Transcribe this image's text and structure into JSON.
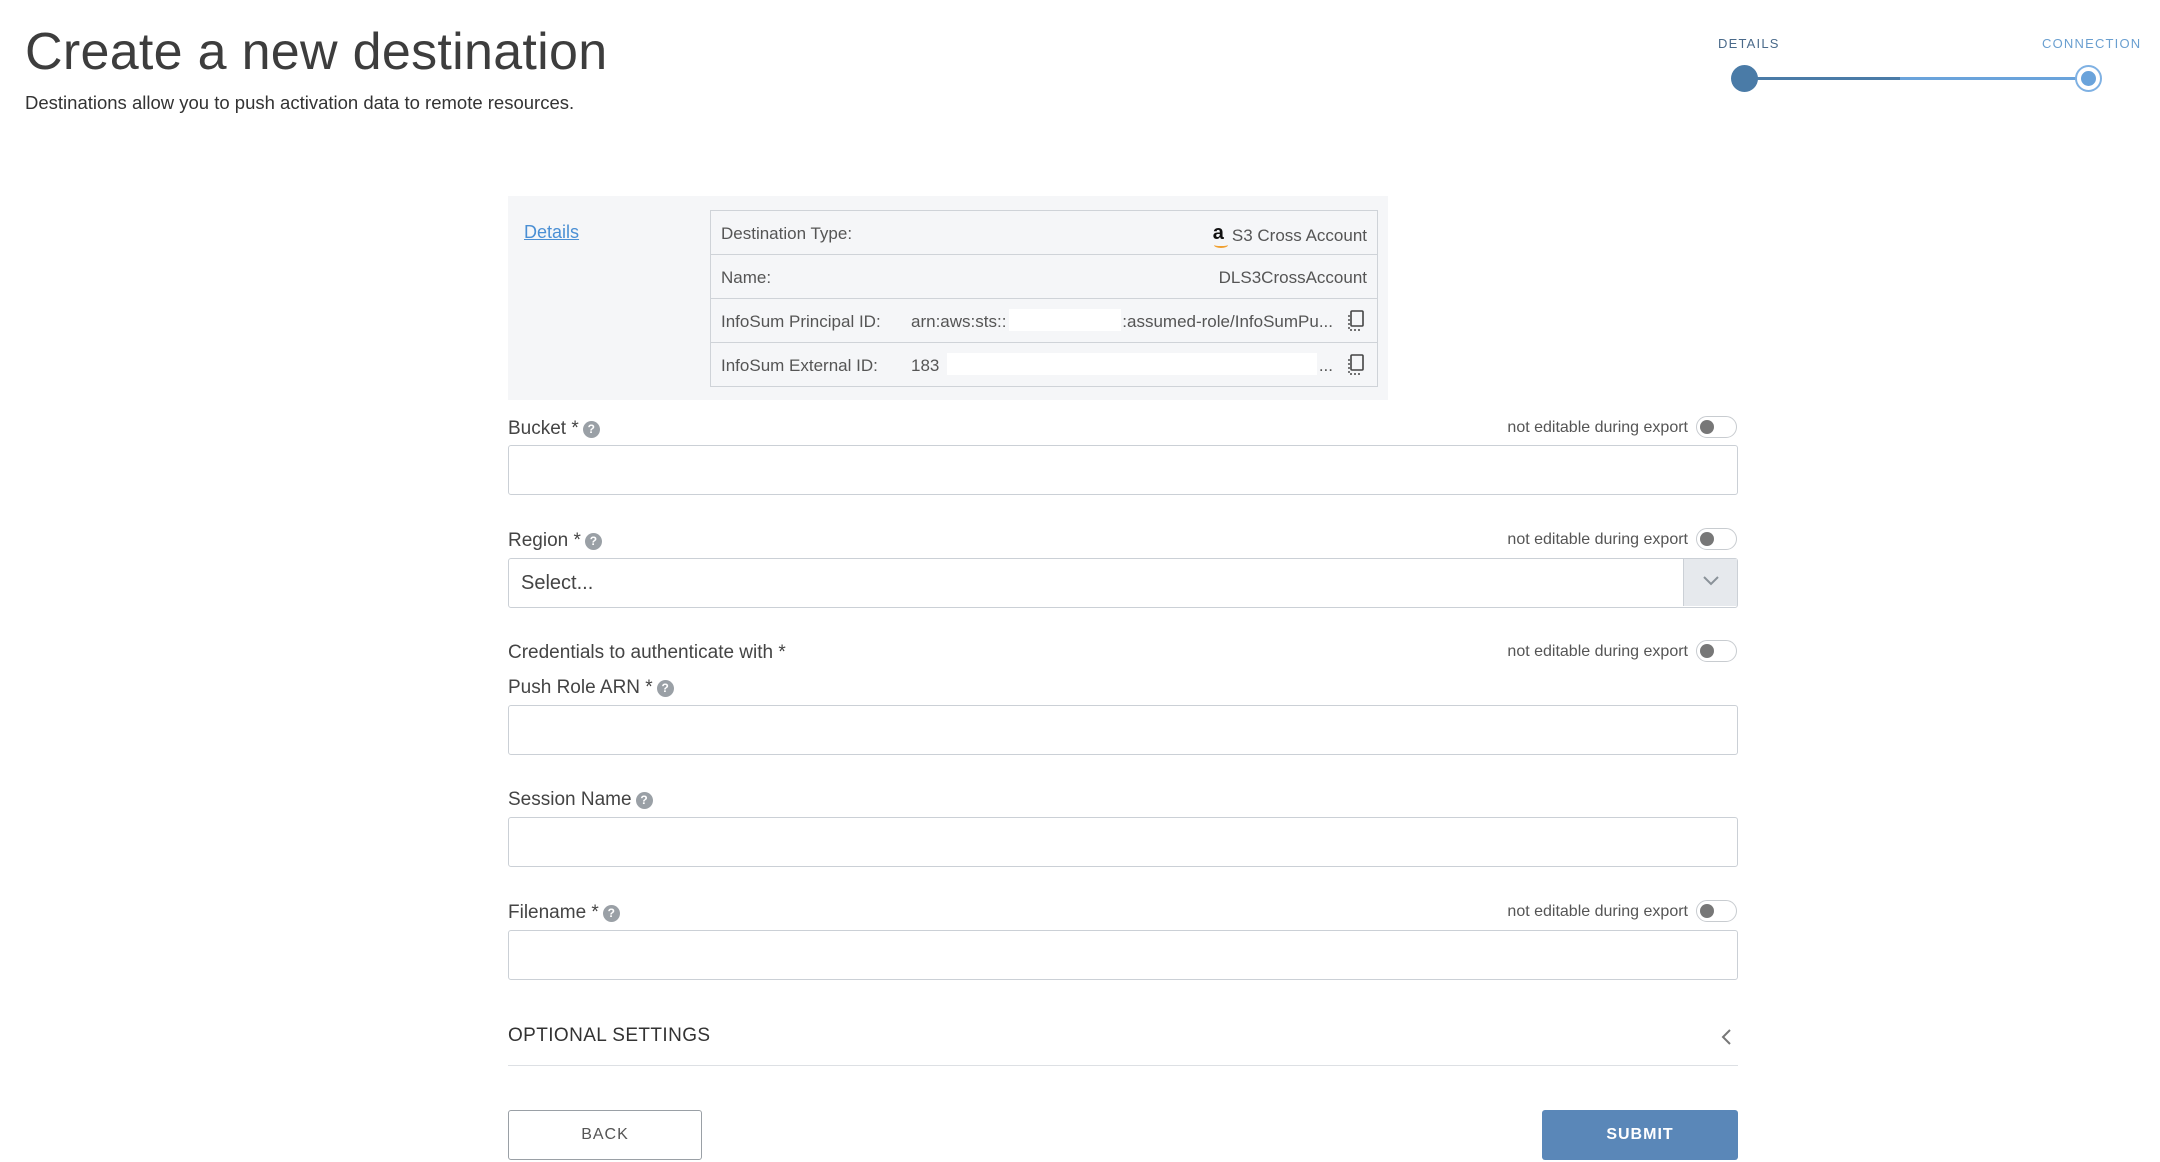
{
  "header": {
    "title": "Create a new destination",
    "subtitle": "Destinations allow you to push activation data to remote resources."
  },
  "stepper": {
    "steps": [
      {
        "label": "DETAILS"
      },
      {
        "label": "CONNECTION"
      }
    ]
  },
  "details": {
    "link_label": "Details",
    "rows": [
      {
        "key": "Destination Type:",
        "value": "S3 Cross Account",
        "icon": "amazon-icon"
      },
      {
        "key": "Name:",
        "value": "DLS3CrossAccount"
      },
      {
        "key": "InfoSum Principal ID:",
        "value_prefix": "arn:aws:sts::",
        "value_suffix": ":assumed-role/InfoSumPu...",
        "icon": "copy-icon"
      },
      {
        "key": "InfoSum External ID:",
        "value_prefix": "183",
        "value_suffix": "...",
        "icon": "copy-icon"
      }
    ]
  },
  "form": {
    "lock_text": "not editable during export",
    "bucket": {
      "label": "Bucket *",
      "value": ""
    },
    "region": {
      "label": "Region *",
      "placeholder": "Select..."
    },
    "credentials": {
      "label": "Credentials to authenticate with *"
    },
    "push_role_arn": {
      "label": "Push Role ARN *",
      "value": ""
    },
    "session_name": {
      "label": "Session Name",
      "value": ""
    },
    "filename": {
      "label": "Filename *",
      "value": ""
    },
    "optional_settings": "OPTIONAL SETTINGS"
  },
  "buttons": {
    "back": "BACK",
    "submit": "SUBMIT"
  },
  "colors": {
    "accent": "#5a87b8",
    "link": "#4a8fd4",
    "step_active": "#4a7ba7"
  }
}
